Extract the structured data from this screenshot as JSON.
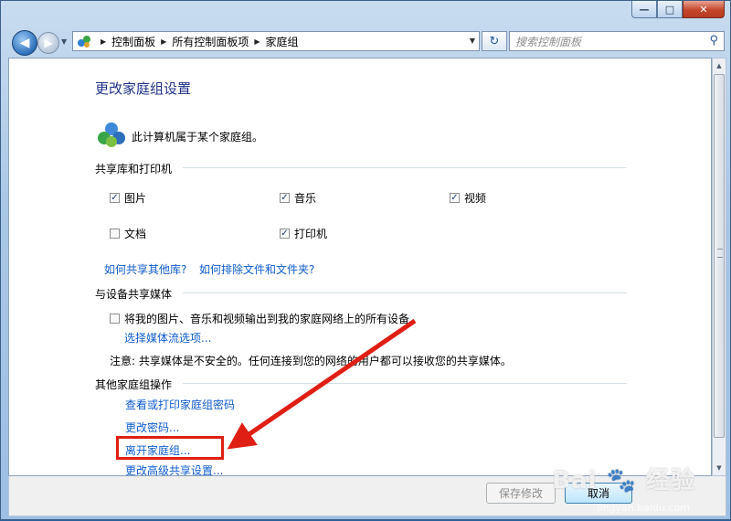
{
  "window": {
    "minimize_glyph": "—",
    "maximize_glyph": "□",
    "close_glyph": "✕"
  },
  "navigation": {
    "back_glyph": "◀",
    "forward_glyph": "▶",
    "breadcrumbs": [
      "控制面板",
      "所有控制面板项",
      "家庭组"
    ],
    "search_placeholder": "搜索控制面板"
  },
  "page": {
    "title": "更改家庭组设置",
    "membership_text": "此计算机属于某个家庭组。"
  },
  "sharing": {
    "section_title": "共享库和打印机",
    "items": [
      {
        "label": "图片",
        "checked": true
      },
      {
        "label": "音乐",
        "checked": true
      },
      {
        "label": "视频",
        "checked": true
      },
      {
        "label": "文档",
        "checked": false
      },
      {
        "label": "打印机",
        "checked": true
      }
    ],
    "links": [
      "如何共享其他库?",
      "如何排除文件和文件夹?"
    ]
  },
  "media": {
    "section_title": "与设备共享媒体",
    "stream_label": "将我的图片、音乐和视频输出到我的家庭网络上的所有设备",
    "stream_checked": false,
    "options_link": "选择媒体流选项...",
    "note": "注意: 共享媒体是不安全的。任何连接到您的网络的用户都可以接收您的共享媒体。"
  },
  "other_actions": {
    "section_title": "其他家庭组操作",
    "links": [
      "查看或打印家庭组密码",
      "更改密码...",
      "离开家庭组...",
      "更改高级共享设置..."
    ]
  },
  "footer": {
    "save_label": "保存修改",
    "cancel_label": "取消"
  },
  "watermark": {
    "brand": "Bai",
    "brand_cn": "经验",
    "url": "jingyan.baidu.com"
  },
  "colors": {
    "link": "#0f5ccc",
    "heading": "#1e3287",
    "annotation": "#e01f14"
  }
}
